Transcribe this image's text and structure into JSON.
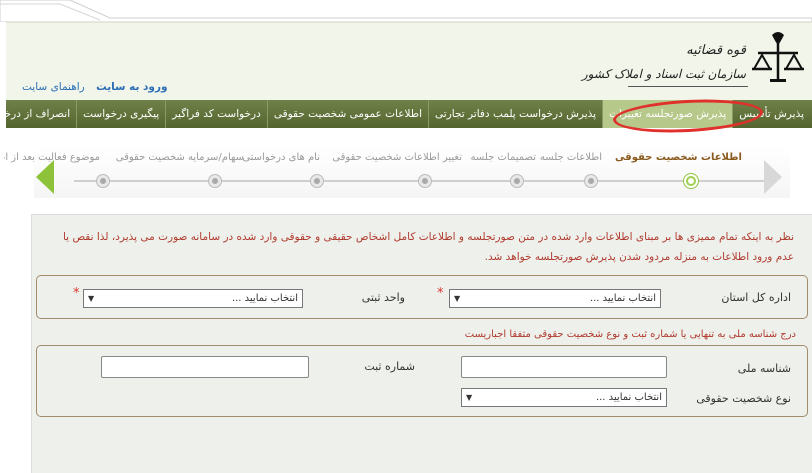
{
  "header": {
    "logo_line1": "قوه قضائیه",
    "logo_line2": "سازمان ثبت اسناد و املاک کشور",
    "links": [
      {
        "label": "ورود به سایت"
      },
      {
        "label": "راهنمای سایت"
      }
    ]
  },
  "nav": {
    "items": [
      {
        "label": "پذیرش تأسیس"
      },
      {
        "label": "پذیرش صورتجلسه تغییرات"
      },
      {
        "label": "پذیرش درخواست پلمب دفاتر تجارتی"
      },
      {
        "label": "اطلاعات عمومی شخصیت حقوقی"
      },
      {
        "label": "درخواست کد فراگیر"
      },
      {
        "label": "پیگیری درخواست"
      },
      {
        "label": "انصراف از درخواست"
      }
    ]
  },
  "steps": [
    {
      "label": "اطلاعات شخصیت حقوقی"
    },
    {
      "label": "اطلاعات جلسه"
    },
    {
      "label": "تصمیمات جلسه"
    },
    {
      "label": "تغییر اطلاعات شخصیت حقوقی"
    },
    {
      "label": "نام های درخواستی"
    },
    {
      "label": "سهام/سرمایه شخصیت حقوقی"
    },
    {
      "label": "موضوع فعالیت بعد از اصلاح"
    }
  ],
  "form": {
    "notice": "نظر به اینکه تمام ممیزی ها بر مبنای اطلاعات وارد شده در متن صورتجلسه و اطلاعات کامل اشخاص حقیقی و حقوقی وارد شده در سامانه صورت می پذیرد، لذا نقص یا عدم ورود اطلاعات به منزله مردود شدن پذیرش صورتجلسه خواهد شد.",
    "province_label": "اداره کل استان",
    "province_value": "انتخاب نمایید ...",
    "unit_label": "واحد ثبتی",
    "unit_value": "انتخاب نمایید ...",
    "required_mark": "*",
    "id_notice": "درج شناسه ملی به تنهایی یا شماره ثبت و نوع شخصیت حقوقی متفقا اجباریست",
    "national_id_label": "شناسه ملی",
    "reg_number_label": "شماره ثبت",
    "entity_type_label": "نوع شخصیت حقوقی",
    "entity_type_value": "انتخاب نمایید ..."
  },
  "colors": {
    "nav_bg": "#5f6f38",
    "nav_active": "#b7c98a",
    "highlight_circle": "#e0302b",
    "notice_text": "#b03a2e",
    "step_active": "#8fc23b"
  }
}
